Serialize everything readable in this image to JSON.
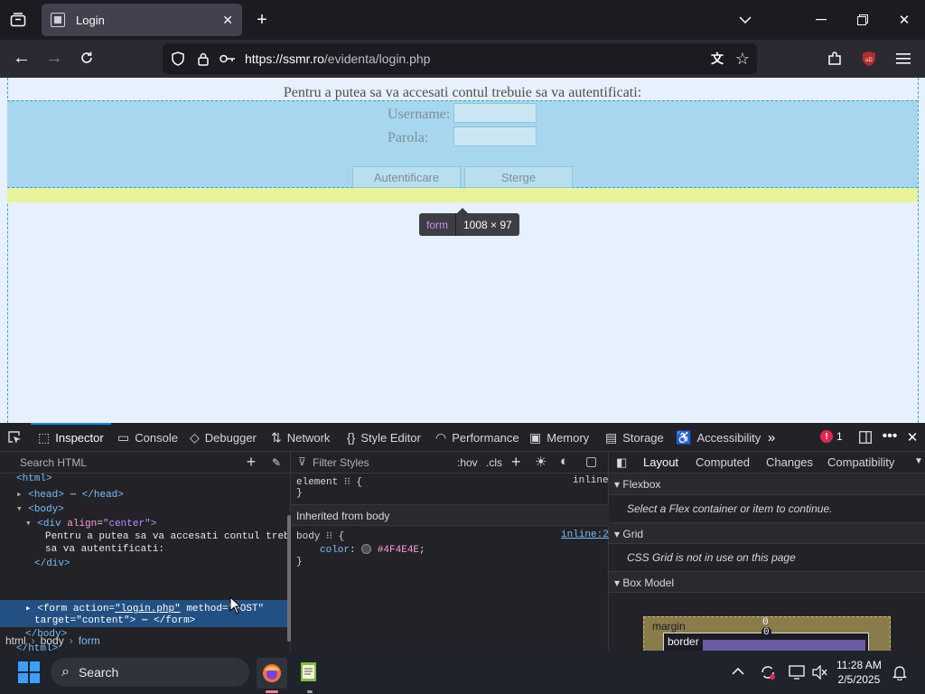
{
  "browser": {
    "tab_title": "Login",
    "url_host": "https://ssmr.ro",
    "url_path": "/evidenta/login.php"
  },
  "page": {
    "intro": "Pentru a putea sa va accesati contul trebuie sa va autentificati:",
    "username_label": "Username:",
    "password_label": "Parola:",
    "submit_label": "Autentificare",
    "reset_label": "Sterge",
    "tooltip_tag": "form",
    "tooltip_dims": "1008 × 97"
  },
  "devtools": {
    "tabs": [
      "Inspector",
      "Console",
      "Debugger",
      "Network",
      "Style Editor",
      "Performance",
      "Memory",
      "Storage",
      "Accessibility"
    ],
    "error_count": "1",
    "search_placeholder": "Search HTML",
    "tree": {
      "html_open": "<html>",
      "head": "<head>",
      "head_close": "</head>",
      "body_open": "<body>",
      "div_open_tag": "<div",
      "div_attr": "align",
      "div_val": "\"center\"",
      "div_text1": "Pentru a putea sa va accesati contul trebuie",
      "div_text2": "sa va autentificati:",
      "div_close": "</div>",
      "form_tag": "<form",
      "form_action_attr": "action",
      "form_action_val": "\"login.php\"",
      "form_method_attr": "method",
      "form_method_val": "\"POST\"",
      "form_target_attr": "target",
      "form_target_val": "\"content\"",
      "form_close": "</form>",
      "body_close": "</body>",
      "html_close": "</html>"
    },
    "breadcrumbs": [
      "html",
      "body",
      "form"
    ],
    "rules": {
      "filter_placeholder": "Filter Styles",
      "hov": ":hov",
      "cls": ".cls",
      "element_selector": "element",
      "inline_label": "inline",
      "inherited_header": "Inherited from body",
      "body_selector": "body",
      "body_source": "inline:2",
      "color_prop": "color",
      "color_value": "#4F4E4E"
    },
    "layout": {
      "tabs": [
        "Layout",
        "Computed",
        "Changes",
        "Compatibility"
      ],
      "flexbox_header": "Flexbox",
      "flexbox_msg": "Select a Flex container or item to continue.",
      "grid_header": "Grid",
      "grid_msg": "CSS Grid is not in use on this page",
      "boxmodel_header": "Box Model",
      "margin_label": "margin",
      "margin_value": "0",
      "border_label": "border",
      "border_value": "0"
    }
  },
  "taskbar": {
    "search_label": "Search",
    "time": "11:28 AM",
    "date": "2/5/2025"
  },
  "colors": {
    "form_highlight": "#a7d7ee",
    "margin_highlight": "#e8f39c",
    "accent": "#0a84ff"
  }
}
